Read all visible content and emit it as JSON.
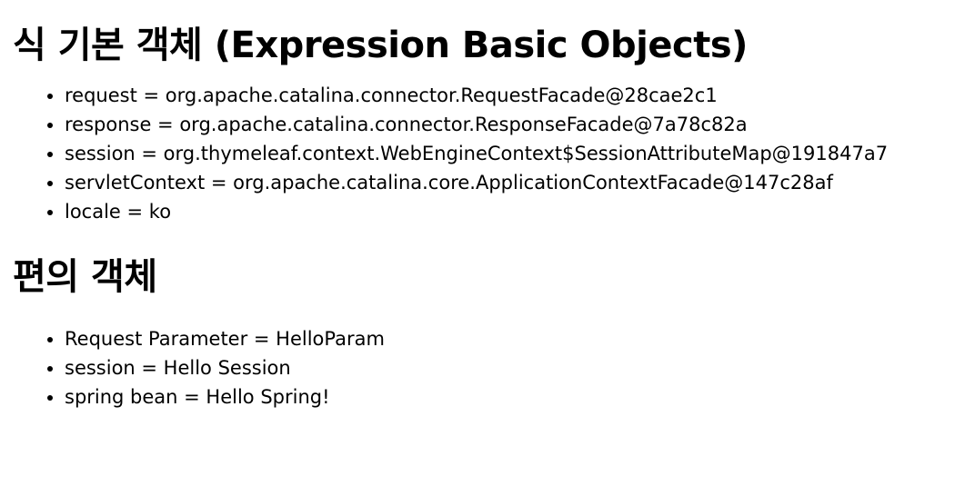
{
  "section_expression": {
    "title": "식 기본 객체 (Expression Basic Objects)",
    "items": [
      "request = org.apache.catalina.connector.RequestFacade@28cae2c1",
      "response = org.apache.catalina.connector.ResponseFacade@7a78c82a",
      "session = org.thymeleaf.context.WebEngineContext$SessionAttributeMap@191847a7",
      "servletContext = org.apache.catalina.core.ApplicationContextFacade@147c28af",
      "locale = ko"
    ]
  },
  "section_convenience": {
    "title": "편의 객체",
    "items": [
      "Request Parameter = HelloParam",
      "session = Hello Session",
      "spring bean = Hello Spring!"
    ]
  }
}
